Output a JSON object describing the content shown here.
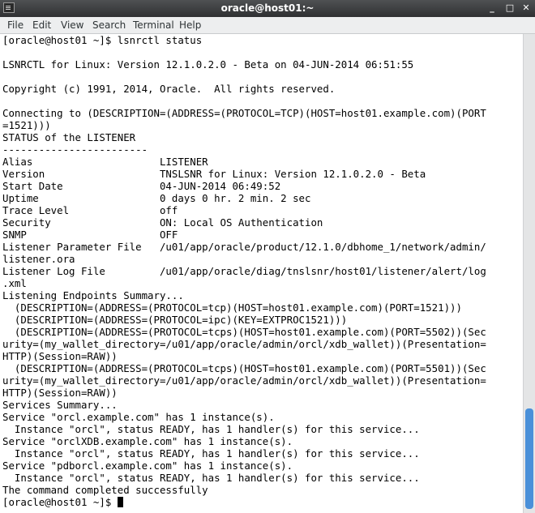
{
  "window": {
    "title": "oracle@host01:~"
  },
  "window_controls": {
    "minimize": "_",
    "maximize": "□",
    "close": "✕"
  },
  "menu": [
    "File",
    "Edit",
    "View",
    "Search",
    "Terminal",
    "Help"
  ],
  "terminal": {
    "lines": [
      "[oracle@host01 ~]$ lsnrctl status",
      "",
      "LSNRCTL for Linux: Version 12.1.0.2.0 - Beta on 04-JUN-2014 06:51:55",
      "",
      "Copyright (c) 1991, 2014, Oracle.  All rights reserved.",
      "",
      "Connecting to (DESCRIPTION=(ADDRESS=(PROTOCOL=TCP)(HOST=host01.example.com)(PORT",
      "=1521)))",
      "STATUS of the LISTENER",
      "------------------------",
      "Alias                     LISTENER",
      "Version                   TNSLSNR for Linux: Version 12.1.0.2.0 - Beta",
      "Start Date                04-JUN-2014 06:49:52",
      "Uptime                    0 days 0 hr. 2 min. 2 sec",
      "Trace Level               off",
      "Security                  ON: Local OS Authentication",
      "SNMP                      OFF",
      "Listener Parameter File   /u01/app/oracle/product/12.1.0/dbhome_1/network/admin/",
      "listener.ora",
      "Listener Log File         /u01/app/oracle/diag/tnslsnr/host01/listener/alert/log",
      ".xml",
      "Listening Endpoints Summary...",
      "  (DESCRIPTION=(ADDRESS=(PROTOCOL=tcp)(HOST=host01.example.com)(PORT=1521)))",
      "  (DESCRIPTION=(ADDRESS=(PROTOCOL=ipc)(KEY=EXTPROC1521)))",
      "  (DESCRIPTION=(ADDRESS=(PROTOCOL=tcps)(HOST=host01.example.com)(PORT=5502))(Sec",
      "urity=(my_wallet_directory=/u01/app/oracle/admin/orcl/xdb_wallet))(Presentation=",
      "HTTP)(Session=RAW))",
      "  (DESCRIPTION=(ADDRESS=(PROTOCOL=tcps)(HOST=host01.example.com)(PORT=5501))(Sec",
      "urity=(my_wallet_directory=/u01/app/oracle/admin/orcl/xdb_wallet))(Presentation=",
      "HTTP)(Session=RAW))",
      "Services Summary...",
      "Service \"orcl.example.com\" has 1 instance(s).",
      "  Instance \"orcl\", status READY, has 1 handler(s) for this service...",
      "Service \"orclXDB.example.com\" has 1 instance(s).",
      "  Instance \"orcl\", status READY, has 1 handler(s) for this service...",
      "Service \"pdborcl.example.com\" has 1 instance(s).",
      "  Instance \"orcl\", status READY, has 1 handler(s) for this service...",
      "The command completed successfully"
    ],
    "prompt": "[oracle@host01 ~]$ "
  }
}
